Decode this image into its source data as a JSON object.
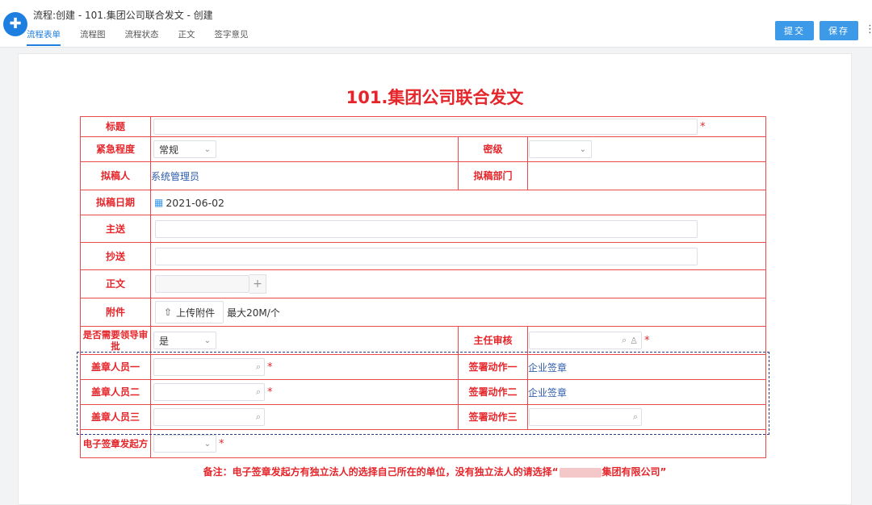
{
  "window": {
    "title": "流程:创建 - 101.集团公司联合发文 - 创建"
  },
  "tabs": [
    {
      "label": "流程表单",
      "active": true
    },
    {
      "label": "流程图"
    },
    {
      "label": "流程状态"
    },
    {
      "label": "正文"
    },
    {
      "label": "签字意见"
    }
  ],
  "toolbar": {
    "submit_label": "提交",
    "save_label": "保存"
  },
  "form": {
    "title": "101.集团公司联合发文",
    "labels": {
      "subject": "标题",
      "urgency": "紧急程度",
      "secrecy": "密级",
      "drafter": "拟稿人",
      "draft_dept": "拟稿部门",
      "draft_date": "拟稿日期",
      "main_to": "主送",
      "cc_to": "抄送",
      "body": "正文",
      "attachment": "附件",
      "need_leader": "是否需要领导审批",
      "director_review": "主任审核",
      "stamp1": "盖章人员一",
      "stamp2": "盖章人员二",
      "stamp3": "盖章人员三",
      "action1": "签署动作一",
      "action2": "签署动作二",
      "action3": "签署动作三",
      "esign_initiator": "电子签章发起方"
    },
    "values": {
      "urgency": "常规",
      "drafter": "系统管理员",
      "draft_date": "2021-06-02",
      "need_leader": "是",
      "action1": "企业签章",
      "action2": "企业签章",
      "upload_label": "上传附件",
      "upload_limit": "最大20M/个"
    },
    "required_mark": "*",
    "note_prefix": "备注：电子签章发起方有独立法人的选择自己所在的单位，没有独立法人的请选择“",
    "note_suffix": "集团有限公司”"
  },
  "colors": {
    "accent": "#1f7fe0",
    "label_red": "#e5252a",
    "border_red": "#ea4a4a",
    "link_blue": "#2f5cab"
  }
}
